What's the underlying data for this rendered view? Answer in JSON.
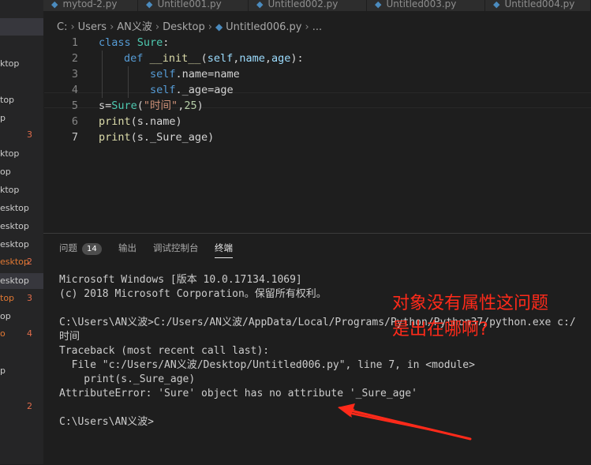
{
  "tabs": [
    {
      "label": "mytod-2.py"
    },
    {
      "label": "Untitle001.py"
    },
    {
      "label": "Untitled002.py"
    },
    {
      "label": "Untitled003.py"
    },
    {
      "label": "Untitled004.py"
    }
  ],
  "sidebar": {
    "items": [
      {
        "label": "ktop",
        "count": ""
      },
      {
        "label": "top",
        "count": ""
      },
      {
        "label": "p",
        "count": ""
      },
      {
        "label": "",
        "count": "3"
      },
      {
        "label": "ktop",
        "count": ""
      },
      {
        "label": "op",
        "count": ""
      },
      {
        "label": "ktop",
        "count": ""
      },
      {
        "label": "esktop",
        "count": ""
      },
      {
        "label": "esktop",
        "count": ""
      },
      {
        "label": "esktop",
        "count": ""
      },
      {
        "label": "esktop",
        "count": "2"
      },
      {
        "label": "esktop",
        "count": ""
      },
      {
        "label": "top",
        "count": "3"
      },
      {
        "label": "op",
        "count": ""
      },
      {
        "label": "o",
        "count": "4"
      },
      {
        "label": "p",
        "count": ""
      },
      {
        "label": "",
        "count": "2"
      }
    ]
  },
  "breadcrumb": {
    "parts": [
      "C:",
      "Users",
      "AN义波",
      "Desktop"
    ],
    "file": "Untitled006.py",
    "tail": "..."
  },
  "editor": {
    "line_numbers": [
      "1",
      "2",
      "3",
      "4",
      "5",
      "6",
      "7"
    ],
    "l1": {
      "kw": "class",
      "name": "Sure",
      "punct": ":"
    },
    "l2": {
      "kw": "def",
      "fn": "__init__",
      "open": "(",
      "p1": "self",
      "c1": ",",
      "p2": "name",
      "c2": ",",
      "p3": "age",
      "close": "):"
    },
    "l3": {
      "self": "self",
      "rest": ".name=name"
    },
    "l4": {
      "self": "self",
      "rest": "._age=age"
    },
    "l5": {
      "a": "s=",
      "cls": "Sure",
      "b": "(",
      "str": "\"时间\"",
      "c": ",",
      "num": "25",
      "d": ")"
    },
    "l6": {
      "fn": "print",
      "rest": "(s.name)"
    },
    "l7": {
      "fn": "print",
      "rest": "(s._Sure_age)"
    }
  },
  "panel": {
    "problems_label": "问题",
    "problems_count": "14",
    "output_label": "输出",
    "debug_label": "调试控制台",
    "terminal_label": "终端"
  },
  "terminal": {
    "lines": [
      "Microsoft Windows [版本 10.0.17134.1069]",
      "(c) 2018 Microsoft Corporation。保留所有权利。",
      "C:\\Users\\AN义波>C:/Users/AN义波/AppData/Local/Programs/Python/Python37/python.exe c:/",
      "时间",
      "Traceback (most recent call last):",
      "  File \"c:/Users/AN义波/Desktop/Untitled006.py\", line 7, in <module>",
      "    print(s._Sure_age)",
      "AttributeError: 'Sure' object has no attribute '_Sure_age'",
      "C:\\Users\\AN义波>"
    ]
  },
  "annotation": {
    "line1": "对象没有属性这问题",
    "line2": "是出在哪啊?",
    "color": "#ff2a1a"
  }
}
